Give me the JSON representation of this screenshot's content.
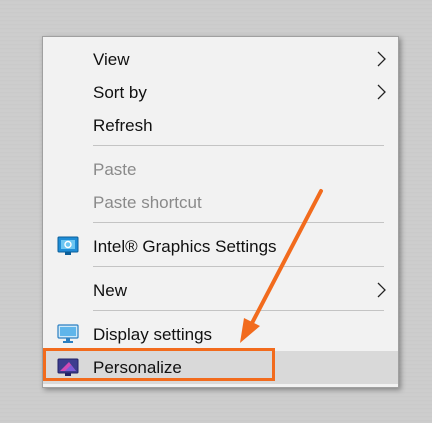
{
  "menu": {
    "items": [
      {
        "label": "View",
        "has_submenu": true,
        "enabled": true
      },
      {
        "label": "Sort by",
        "has_submenu": true,
        "enabled": true
      },
      {
        "label": "Refresh",
        "has_submenu": false,
        "enabled": true
      },
      {
        "label": "Paste",
        "has_submenu": false,
        "enabled": false
      },
      {
        "label": "Paste shortcut",
        "has_submenu": false,
        "enabled": false
      },
      {
        "label": "Intel® Graphics Settings",
        "has_submenu": false,
        "enabled": true,
        "icon": "intel-graphics-icon"
      },
      {
        "label": "New",
        "has_submenu": true,
        "enabled": true
      },
      {
        "label": "Display settings",
        "has_submenu": false,
        "enabled": true,
        "icon": "display-monitor-icon"
      },
      {
        "label": "Personalize",
        "has_submenu": false,
        "enabled": true,
        "icon": "personalize-icon",
        "highlighted": true
      }
    ]
  },
  "annotation": {
    "color": "#f26b1d",
    "target": "Personalize"
  }
}
